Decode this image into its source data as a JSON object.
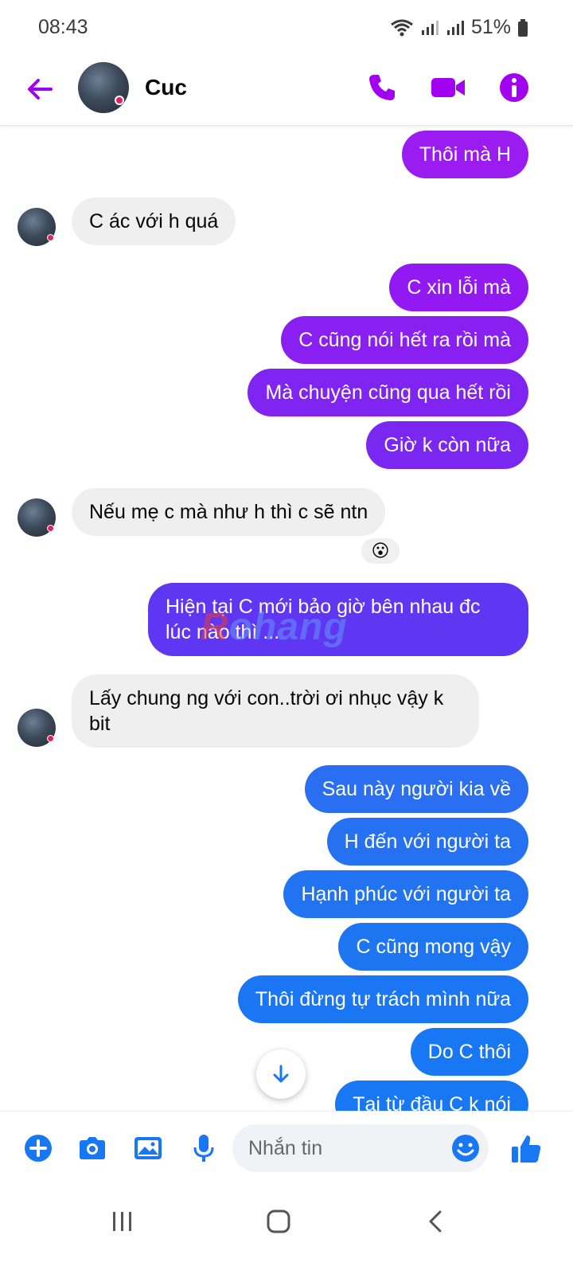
{
  "status_bar": {
    "time": "08:43",
    "battery": "51%"
  },
  "header": {
    "contact_name": "Cuc"
  },
  "colors": {
    "accent": "#a200f0",
    "bubble_purple": "#9b1cf0",
    "bubble_violet": "#6d2ff2",
    "bubble_blue": "#1877f2",
    "incoming": "#efefef"
  },
  "messages": [
    {
      "dir": "out",
      "text": "Thôi mà H"
    },
    {
      "dir": "in",
      "text": "C ác với h quá"
    },
    {
      "dir": "out",
      "text": "C xin lỗi mà"
    },
    {
      "dir": "out",
      "text": "C cũng nói hết ra rồi mà"
    },
    {
      "dir": "out",
      "text": "Mà chuyện cũng qua hết rồi"
    },
    {
      "dir": "out",
      "text": "Giờ k còn nữa"
    },
    {
      "dir": "in",
      "text": "Nếu mẹ c mà như h thì c sẽ ntn",
      "reaction": "😮"
    },
    {
      "dir": "out",
      "text": "Hiện tại C mới bảo giờ bên nhau đc lúc nào thì ..."
    },
    {
      "dir": "in",
      "text": "Lấy chung ng với con..trời ơi nhục vậy k bit"
    },
    {
      "dir": "out",
      "text": "Sau này người kia về"
    },
    {
      "dir": "out",
      "text": "H đến với người ta"
    },
    {
      "dir": "out",
      "text": "Hạnh phúc với người ta"
    },
    {
      "dir": "out",
      "text": "C cũng mong vậy"
    },
    {
      "dir": "out",
      "text": "Thôi đừng tự trách mình nữa"
    },
    {
      "dir": "out",
      "text": "Do C thôi"
    },
    {
      "dir": "out",
      "text": "Tại từ đầu C k nói"
    }
  ],
  "watermark": {
    "text_r": "R",
    "text_rest": "ohang"
  },
  "composer": {
    "placeholder": "Nhắn tin",
    "icons": [
      "plus-icon",
      "camera-icon",
      "image-icon",
      "microphone-icon",
      "emoji-icon",
      "thumbs-up-icon"
    ]
  },
  "nav": {
    "icons": [
      "recent-apps-icon",
      "home-icon",
      "back-icon"
    ]
  }
}
